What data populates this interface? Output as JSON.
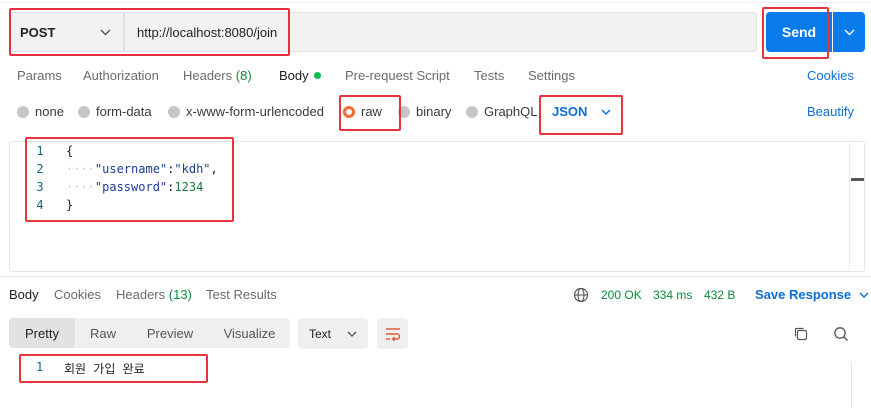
{
  "request": {
    "method": "POST",
    "url": "http://localhost:8080/join",
    "send_label": "Send"
  },
  "request_tabs": [
    {
      "label": "Params"
    },
    {
      "label": "Authorization"
    },
    {
      "label": "Headers",
      "count": "(8)"
    },
    {
      "label": "Body"
    },
    {
      "label": "Pre-request Script"
    },
    {
      "label": "Tests"
    },
    {
      "label": "Settings"
    }
  ],
  "cookies_label": "Cookies",
  "body_types": [
    "none",
    "form-data",
    "x-www-form-urlencoded",
    "raw",
    "binary",
    "GraphQL"
  ],
  "body_type_selected": "raw",
  "format_selected": "JSON",
  "beautify_label": "Beautify",
  "editor": {
    "lines": [
      {
        "num": "1",
        "text": "{"
      },
      {
        "num": "2",
        "key": "\"username\"",
        "sep": ":",
        "value": "\"kdh\"",
        "trail": ","
      },
      {
        "num": "3",
        "key": "\"password\"",
        "sep": ":",
        "value": "1234",
        "trail": ""
      },
      {
        "num": "4",
        "text": "}"
      }
    ]
  },
  "response_tabs": [
    {
      "label": "Body"
    },
    {
      "label": "Cookies"
    },
    {
      "label": "Headers",
      "count": "(13)"
    },
    {
      "label": "Test Results"
    }
  ],
  "response_status": {
    "status": "200 OK",
    "time": "334 ms",
    "size": "432 B"
  },
  "save_response_label": "Save Response",
  "view_modes": [
    "Pretty",
    "Raw",
    "Preview",
    "Visualize"
  ],
  "response_format": "Text",
  "response_body": {
    "line_num": "1",
    "text": "회원 가입 완료"
  },
  "colors": {
    "accent_blue": "#097bed",
    "link_blue": "#0b6fd6",
    "status_green": "#0a8a3a",
    "highlight_red": "#e8333f",
    "radio_orange": "#f26b3a"
  }
}
